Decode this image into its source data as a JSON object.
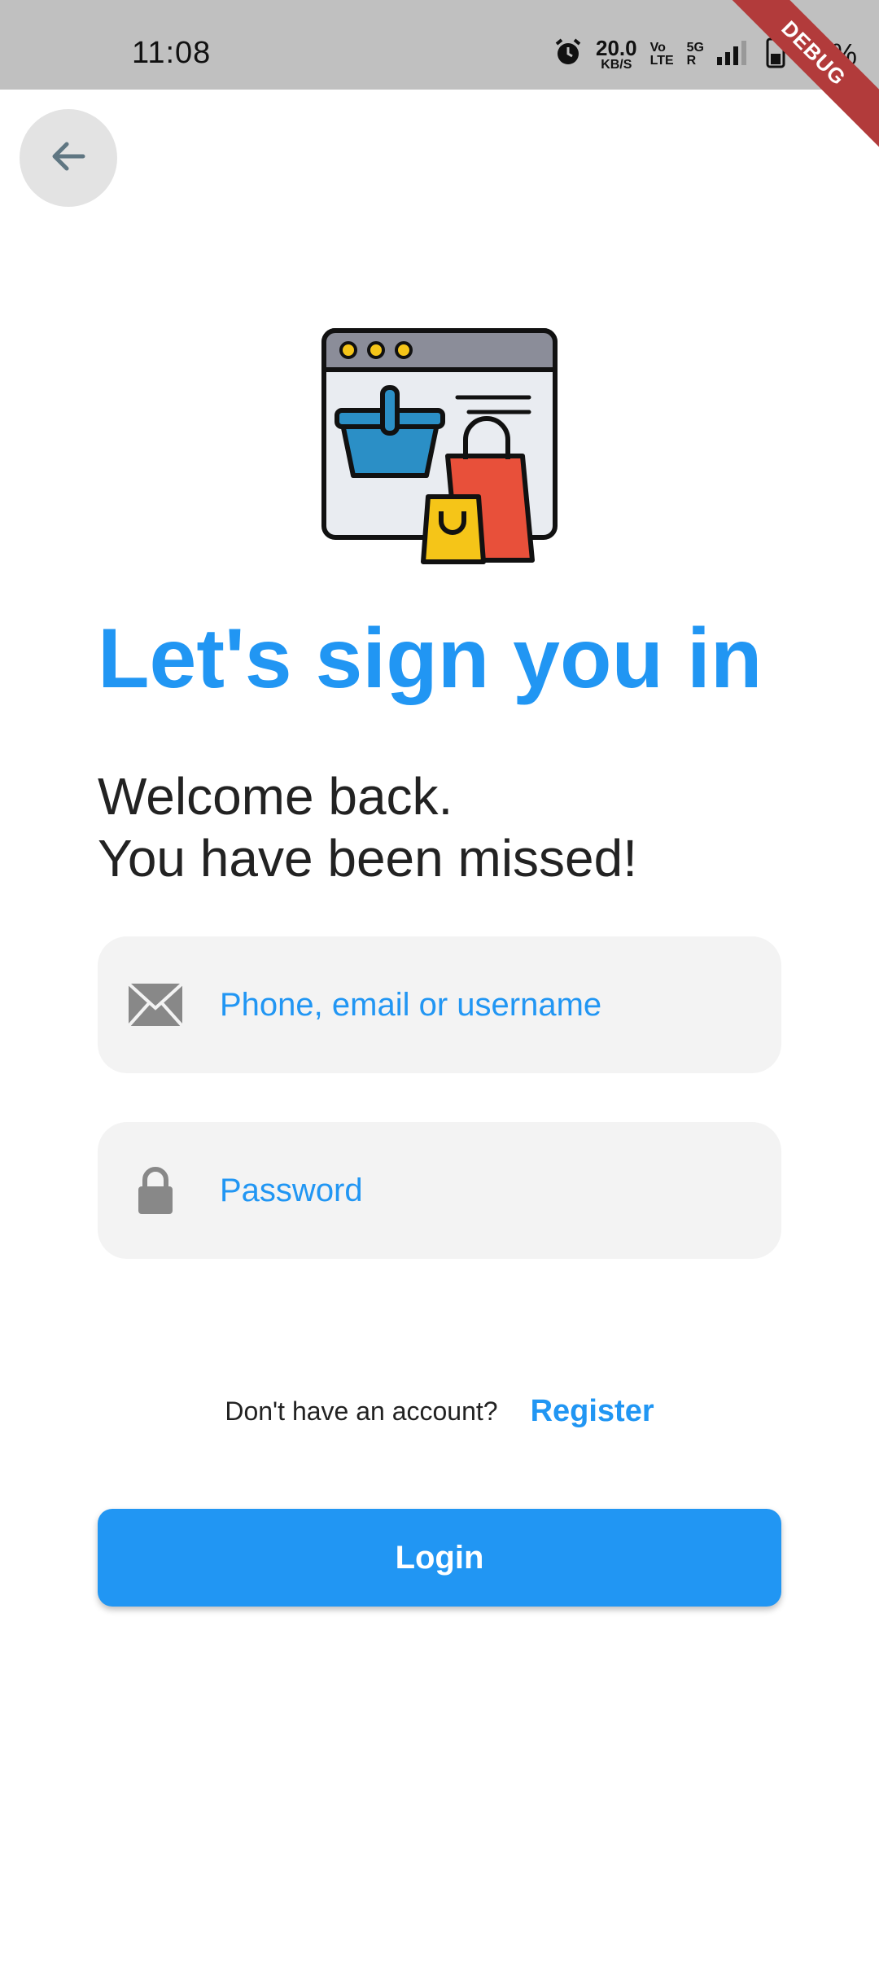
{
  "status_bar": {
    "time": "11:08",
    "speed_value": "20.0",
    "speed_unit": "KB/S",
    "volte_top": "Vo",
    "volte_bottom": "LTE",
    "network_top": "5G",
    "network_bottom": "R",
    "battery_percent": "43%",
    "icons": [
      "alarm-icon",
      "signal-icon",
      "battery-icon"
    ]
  },
  "debug_banner": "DEBUG",
  "header": {
    "back_icon": "arrow-left-icon"
  },
  "illustration": {
    "icon": "shopping-window-icon"
  },
  "main": {
    "title": "Let's sign you in",
    "subtitle_line1": "Welcome back.",
    "subtitle_line2": "You have been missed!"
  },
  "form": {
    "email": {
      "placeholder": "Phone, email or username",
      "value": "",
      "icon": "envelope-icon"
    },
    "password": {
      "placeholder": "Password",
      "value": "",
      "icon": "lock-icon"
    }
  },
  "register": {
    "question": "Don't have an account?",
    "link": "Register"
  },
  "login_button": "Login",
  "colors": {
    "accent": "#2196f3",
    "field_bg": "#f3f3f3",
    "status_bar_bg": "#c0c0c0",
    "debug_banner": "#b23b3b"
  }
}
